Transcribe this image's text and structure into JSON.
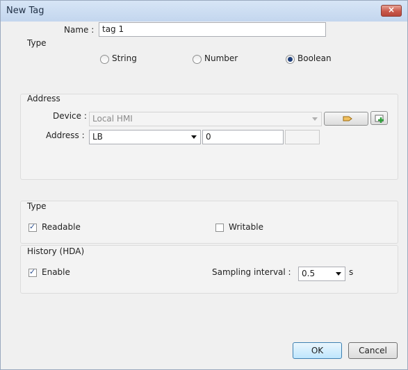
{
  "window": {
    "title": "New Tag",
    "close": "×"
  },
  "name": {
    "label": "Name :",
    "value": "tag 1"
  },
  "type_group": {
    "label": "Type",
    "options": [
      "String",
      "Number",
      "Boolean"
    ],
    "selected": "Boolean"
  },
  "address_group": {
    "label": "Address",
    "device_label": "Device :",
    "device_value": "Local HMI",
    "address_label": "Address :",
    "address_type": "LB",
    "address_value": "0"
  },
  "access_group": {
    "label": "Type",
    "readable": "Readable",
    "readable_checked": true,
    "writable": "Writable",
    "writable_checked": false
  },
  "history_group": {
    "label": "History (HDA)",
    "enable": "Enable",
    "enable_checked": true,
    "interval_label": "Sampling interval :",
    "interval_value": "0.5",
    "interval_unit": "s"
  },
  "buttons": {
    "ok": "OK",
    "cancel": "Cancel"
  }
}
